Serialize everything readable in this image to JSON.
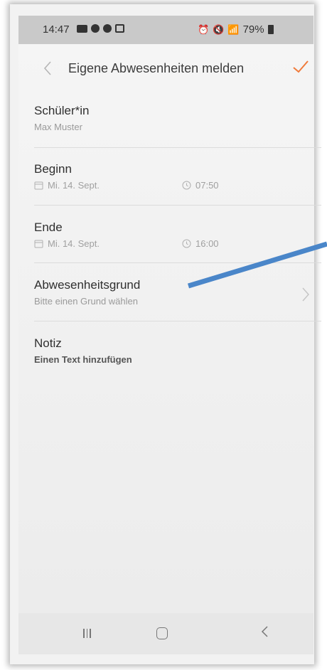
{
  "status_bar": {
    "time": "14:47",
    "battery": "79%"
  },
  "header": {
    "title": "Eigene Abwesenheiten melden",
    "confirm_color": "#f07a3a"
  },
  "fields": {
    "student": {
      "label": "Schüler*in",
      "value": "Max Muster"
    },
    "begin": {
      "label": "Beginn",
      "date": "Mi. 14. Sept.",
      "time": "07:50"
    },
    "end": {
      "label": "Ende",
      "date": "Mi. 14. Sept.",
      "time": "16:00"
    },
    "reason": {
      "label": "Abwesenheitsgrund",
      "placeholder": "Bitte einen Grund wählen"
    },
    "note": {
      "label": "Notiz",
      "placeholder": "Einen Text hinzufügen"
    }
  },
  "annotation": {
    "arrow_color": "#4a86c9"
  },
  "icons": {
    "back": "chevron-left-icon",
    "confirm": "check-icon",
    "calendar": "calendar-icon",
    "clock": "clock-icon",
    "reason_chevron": "chevron-right-icon"
  }
}
